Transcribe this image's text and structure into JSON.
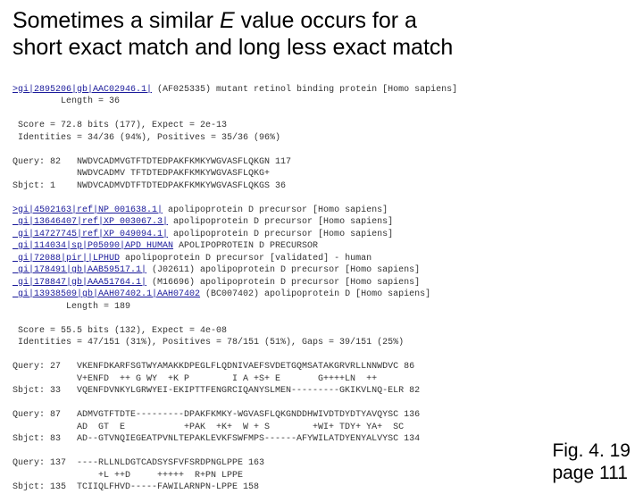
{
  "title_lines": [
    "Sometimes a similar E value occurs for a",
    "short exact match and long less exact match"
  ],
  "caption_lines": [
    "Fig. 4. 19",
    "page 111"
  ],
  "hit1": {
    "defline_link": ">gi|2895206|gb|AAC02946.1|",
    "defline_rest": " (AF025335) mutant retinol binding protein [Homo sapiens]",
    "length": "         Length = 36",
    "score": " Score = 72.8 bits (177), Expect = 2e-13",
    "ident": " Identities = 34/36 (94%), Positives = 35/36 (96%)",
    "q": "Query: 82   NWDVCADMVGTFTDTEDPAKFKMKYWGVASFLQKGN 117",
    "m": "            NWDVCADMV TFTDTEDPAKFKMKYWGVASFLQKG+",
    "s": "Sbjct: 1    NWDVCADMVDTFTDTEDPAKFKMKYWGVASFLQKGS 36"
  },
  "hit2": {
    "l0_link": ">gi|4502163|ref|NP 001638.1|",
    "l0_rest": " apolipoprotein D precursor [Homo sapiens]",
    "l1_link": " gi|13646407|ref|XP 003067.3|",
    "l1_rest": " apolipoprotein D precursor [Homo sapiens]",
    "l2_link": " gi|14727745|ref|XP 049094.1|",
    "l2_rest": " apolipoprotein D precursor [Homo sapiens]",
    "l3_link": " gi|114034|sp|P05090|APD HUMAN",
    "l3_rest": " APOLIPOPROTEIN D PRECURSOR",
    "l4_link": " gi|72088|pir||LPHUD",
    "l4_rest": " apolipoprotein D precursor [validated] - human",
    "l5_link": " gi|178491|gb|AAB59517.1|",
    "l5_rest": " (J02611) apolipoprotein D precursor [Homo sapiens]",
    "l6_link": " gi|178847|gb|AAA51764.1|",
    "l6_rest": " (M16696) apolipoprotein D precursor [Homo sapiens]",
    "l7_link": " gi|13938509|gb|AAH07402.1|AAH07402",
    "l7_rest": " (BC007402) apolipoprotein D [Homo sapiens]",
    "length": "          Length = 189",
    "score": " Score = 55.5 bits (132), Expect = 4e-08",
    "ident": " Identities = 47/151 (31%), Positives = 78/151 (51%), Gaps = 39/151 (25%)",
    "q1": "Query: 27   VKENFDKARFSGTWYAMAKKDPEGLFLQDNIVAEFSVDETGQMSATAKGRVRLLNNWDVC 86",
    "m1": "            V+ENFD  ++ G WY  +K P        I A +S+ E       G++++LN  ++",
    "s1": "Sbjct: 33   VQENFDVNKYLGRWYEI-EKIPTTFENGRCIQANYSLMEN---------GKIKVLNQ-ELR 82",
    "q2": "Query: 87   ADMVGTFTDTE---------DPAKFKMKY-WGVASFLQKGNDDHWIVDTDYDTYAVQYSC 136",
    "m2": "            AD  GT  E           +PAK  +K+  W + S        +WI+ TDY+ YA+  SC",
    "s2": "Sbjct: 83   AD--GTVNQIEGEATPVNLTEPAKLEVKFSWFMPS------AFYWILATDYENYALVYSC 134",
    "q3": "Query: 137  ----RLLNLDGTCADSYSFVFSRDPNGLPPE 163",
    "m3": "                +L ++D     +++++  R+PN LPPE",
    "s3": "Sbjct: 135  TCIIQLFHVD-----FAWILARNPN-LPPE 158"
  }
}
